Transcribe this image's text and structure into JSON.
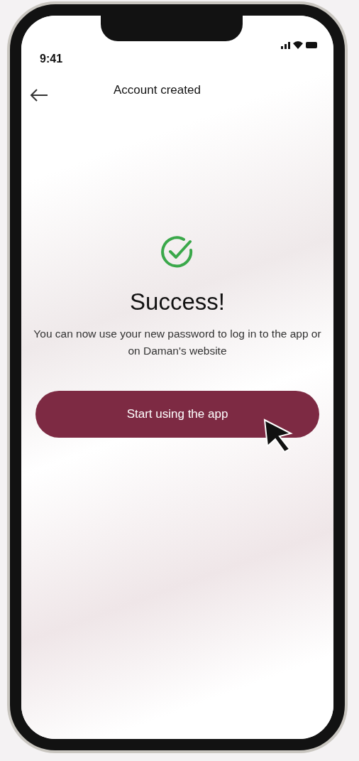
{
  "status_bar": {
    "time": "9:41"
  },
  "header": {
    "title": "Account created"
  },
  "title": "Success!",
  "message": "You can now use your new password to log in to the app or on Daman's website",
  "button": {
    "label": "Start using the app"
  }
}
